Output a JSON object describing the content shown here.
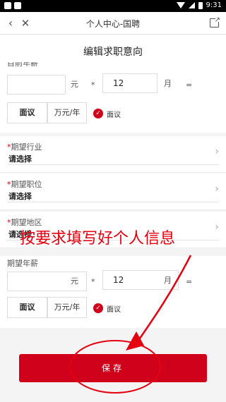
{
  "status_bar": {
    "time": "9:31"
  },
  "navbar": {
    "title": "个人中心-国聘"
  },
  "page_title": "编辑求职意向",
  "partial_label": "目前年薪",
  "current_salary": {
    "amount_value": "",
    "amount_unit": "元",
    "multiply": "*",
    "months_value": "12",
    "months_unit": "月",
    "equals": "=",
    "negotiable_select": "面议",
    "total_unit": "万元/年",
    "negotiable_check_label": "面议"
  },
  "fields": {
    "industry": {
      "required_mark": "*",
      "label": "期望行业",
      "value": "请选择"
    },
    "position": {
      "required_mark": "*",
      "label": "期望职位",
      "value": "请选择"
    },
    "region": {
      "required_mark": "*",
      "label": "期望地区",
      "value": "请选择"
    }
  },
  "expected_salary": {
    "label": "期望年薪",
    "amount_value": "",
    "amount_unit": "元",
    "multiply": "*",
    "months_value": "12",
    "months_unit": "月",
    "equals": "=",
    "negotiable_select": "面议",
    "total_unit": "万元/年",
    "negotiable_check_label": "面议"
  },
  "annotation": "按要求填写好个人信息",
  "save_label": "保存",
  "colors": {
    "accent": "#d0021b",
    "annotation": "#e4000f"
  }
}
